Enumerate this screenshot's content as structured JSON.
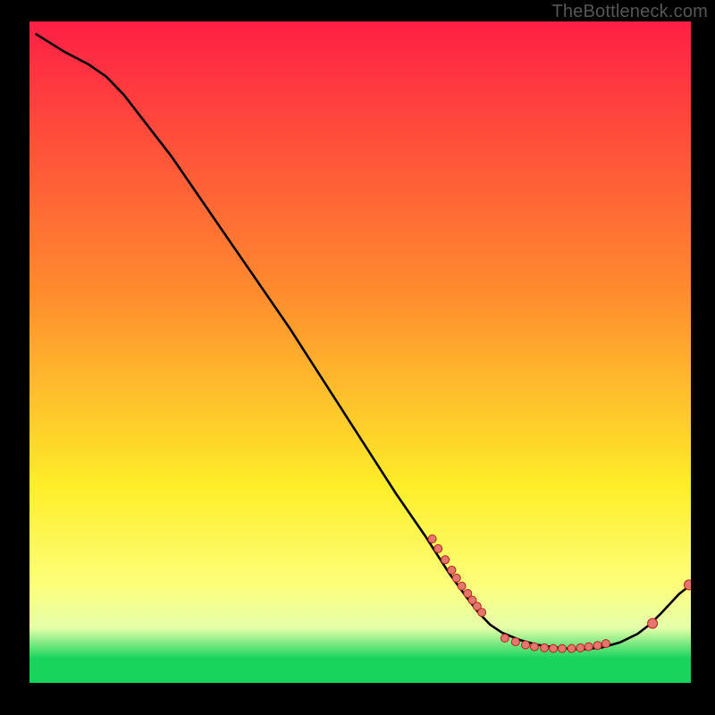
{
  "attribution": "TheBottleneck.com",
  "colors": {
    "curve": "#000000",
    "dot_fill": "#e4766f",
    "dot_stroke": "#b7241c",
    "frame_black": "#000000",
    "gradient_top": "#ff1f45",
    "gradient_orange": "#ff8b2e",
    "gradient_yellow": "#feee29",
    "gradient_pale": "#e6ffaa",
    "gradient_green": "#18d45d"
  },
  "chart_data": {
    "type": "line",
    "title": "",
    "xlabel": "",
    "ylabel": "",
    "xlim": [
      -4,
      108
    ],
    "ylim": [
      -4,
      104
    ],
    "curve": {
      "x": [
        -3,
        2,
        6,
        9,
        12,
        20,
        30,
        40,
        50,
        58,
        63,
        67,
        70,
        72,
        74,
        76,
        79,
        82,
        85,
        88,
        90,
        93,
        96,
        99,
        101,
        103,
        106,
        108
      ],
      "y": [
        102,
        99,
        97,
        95,
        92,
        82,
        68,
        54,
        39,
        27,
        20,
        14,
        10,
        7.5,
        5.5,
        4.2,
        3.0,
        2.2,
        1.8,
        1.5,
        1.5,
        1.8,
        2.6,
        4.0,
        5.5,
        7.4,
        10.5,
        12
      ]
    },
    "series": [
      {
        "name": "dense-dots",
        "x": [
          64.2,
          65.2,
          66.4,
          67.5,
          68.3,
          69.2,
          70.2,
          71.0,
          71.8,
          72.6
        ],
        "y": [
          19.5,
          17.9,
          16.1,
          14.4,
          13.1,
          11.8,
          10.6,
          9.5,
          8.5,
          7.5
        ]
      },
      {
        "name": "valley-dots",
        "x": [
          76.5,
          78.3,
          80.0,
          81.5,
          83.2,
          84.7,
          86.2,
          87.8,
          89.3,
          90.7,
          92.2,
          93.6
        ],
        "y": [
          3.3,
          2.7,
          2.2,
          1.9,
          1.7,
          1.6,
          1.6,
          1.6,
          1.7,
          1.9,
          2.1,
          2.4
        ]
      },
      {
        "name": "rise-dots",
        "x": [
          101.5,
          107.7
        ],
        "y": [
          5.7,
          12.0
        ]
      }
    ]
  }
}
